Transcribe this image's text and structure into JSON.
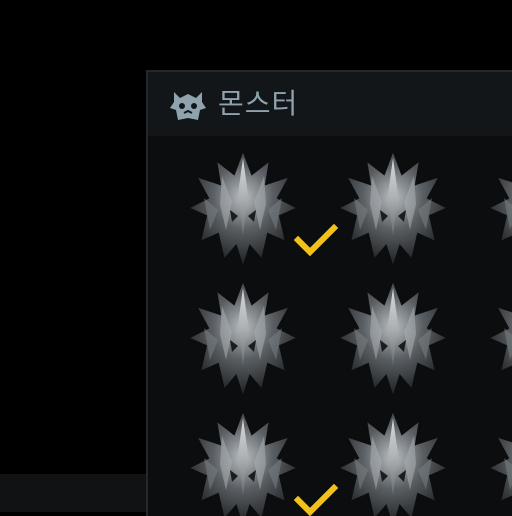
{
  "panel": {
    "title": "몬스터",
    "title_icon": "monster-skull-icon",
    "title_color": "#8fa3ae",
    "check_color": "#f2c21b"
  },
  "slots": [
    {
      "icon": "monster-head-icon",
      "checked": true
    },
    {
      "icon": "monster-head-icon",
      "checked": false
    },
    {
      "icon": "monster-head-icon",
      "checked": false
    },
    {
      "icon": "monster-head-icon",
      "checked": false
    },
    {
      "icon": "monster-head-icon",
      "checked": false
    },
    {
      "icon": "monster-head-icon",
      "checked": false
    },
    {
      "icon": "monster-head-icon",
      "checked": true
    },
    {
      "icon": "monster-head-icon",
      "checked": false
    },
    {
      "icon": "monster-head-icon",
      "checked": false
    }
  ]
}
